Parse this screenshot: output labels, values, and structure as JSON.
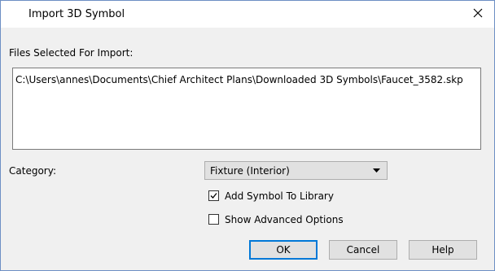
{
  "dialog": {
    "title": "Import 3D Symbol"
  },
  "files": {
    "label": "Files Selected For Import:",
    "path": "C:\\Users\\annes\\Documents\\Chief Architect Plans\\Downloaded 3D Symbols\\Faucet_3582.skp"
  },
  "category": {
    "label": "Category:",
    "selected": "Fixture (Interior)"
  },
  "options": {
    "add_to_library": {
      "label": "Add Symbol To Library",
      "checked": true
    },
    "show_advanced": {
      "label": "Show Advanced Options",
      "checked": false
    }
  },
  "buttons": {
    "ok": "OK",
    "cancel": "Cancel",
    "help": "Help"
  },
  "icons": {
    "close": "close-icon",
    "dropdown": "chevron-down-icon",
    "check": "checkmark-icon"
  },
  "colors": {
    "default_button_border": "#0078d7",
    "window_border": "#6d8fc4"
  }
}
